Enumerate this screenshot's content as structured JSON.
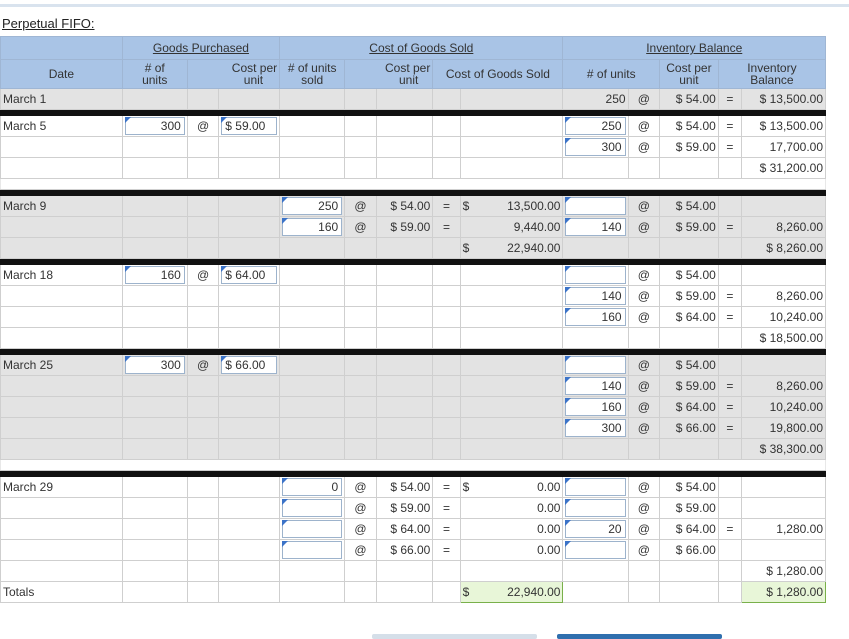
{
  "title": "Perpetual FIFO:",
  "headers": {
    "goods_purchased": "Goods Purchased",
    "cost_of_goods_sold": "Cost of Goods Sold",
    "inventory_balance": "Inventory Balance",
    "date": "Date",
    "gp_units_line1": "# of",
    "gp_units_line2": "units",
    "cost_per_line1": "Cost per",
    "cost_per_line2": "unit",
    "sold_line1": "# of units",
    "sold_line2": "sold",
    "cogs": "Cost of Goods Sold",
    "inv_units": "# of units",
    "inv_balance_line1": "Inventory",
    "inv_balance_line2": "Balance"
  },
  "symbols": {
    "at": "@",
    "eq": "=",
    "dollar": "$"
  },
  "march1": {
    "date": "March 1",
    "units": "250",
    "cost": "$ 54.00",
    "balance": "$ 13,500.00"
  },
  "march5": {
    "date": "March 5",
    "purchase_units": "300",
    "purchase_cost": "$ 59.00",
    "inv": [
      {
        "units": "250",
        "cost": "$ 54.00",
        "balance": "$ 13,500.00"
      },
      {
        "units": "300",
        "cost": "$ 59.00",
        "balance": "17,700.00"
      }
    ],
    "total": "$ 31,200.00"
  },
  "march9": {
    "date": "March 9",
    "sold": [
      {
        "units": "250",
        "cost": "$ 54.00",
        "cogs": "13,500.00"
      },
      {
        "units": "160",
        "cost": "$ 59.00",
        "cogs": "9,440.00"
      }
    ],
    "cogs_total": "22,940.00",
    "inv": [
      {
        "units": "",
        "cost": "$ 54.00",
        "balance": ""
      },
      {
        "units": "140",
        "cost": "$ 59.00",
        "balance": "8,260.00"
      }
    ],
    "total": "$ 8,260.00"
  },
  "march18": {
    "date": "March 18",
    "purchase_units": "160",
    "purchase_cost": "$ 64.00",
    "inv": [
      {
        "units": "",
        "cost": "$ 54.00",
        "balance": ""
      },
      {
        "units": "140",
        "cost": "$ 59.00",
        "balance": "8,260.00"
      },
      {
        "units": "160",
        "cost": "$ 64.00",
        "balance": "10,240.00"
      }
    ],
    "total": "$ 18,500.00"
  },
  "march25": {
    "date": "March 25",
    "purchase_units": "300",
    "purchase_cost": "$ 66.00",
    "inv": [
      {
        "units": "",
        "cost": "$ 54.00",
        "balance": ""
      },
      {
        "units": "140",
        "cost": "$ 59.00",
        "balance": "8,260.00"
      },
      {
        "units": "160",
        "cost": "$ 64.00",
        "balance": "10,240.00"
      },
      {
        "units": "300",
        "cost": "$ 66.00",
        "balance": "19,800.00"
      }
    ],
    "total": "$ 38,300.00"
  },
  "march29": {
    "date": "March 29",
    "sold": [
      {
        "units": "0",
        "cost": "$ 54.00",
        "cogs": "0.00"
      },
      {
        "units": "",
        "cost": "$ 59.00",
        "cogs": "0.00"
      },
      {
        "units": "",
        "cost": "$ 64.00",
        "cogs": "0.00"
      },
      {
        "units": "",
        "cost": "$ 66.00",
        "cogs": "0.00"
      }
    ],
    "inv": [
      {
        "units": "",
        "cost": "$ 54.00",
        "balance": ""
      },
      {
        "units": "",
        "cost": "$ 59.00",
        "balance": ""
      },
      {
        "units": "20",
        "cost": "$ 64.00",
        "balance": "1,280.00"
      },
      {
        "units": "",
        "cost": "$ 66.00",
        "balance": ""
      }
    ],
    "total": "$ 1,280.00"
  },
  "totals": {
    "label": "Totals",
    "cogs": "22,940.00",
    "balance": "$ 1,280.00"
  }
}
